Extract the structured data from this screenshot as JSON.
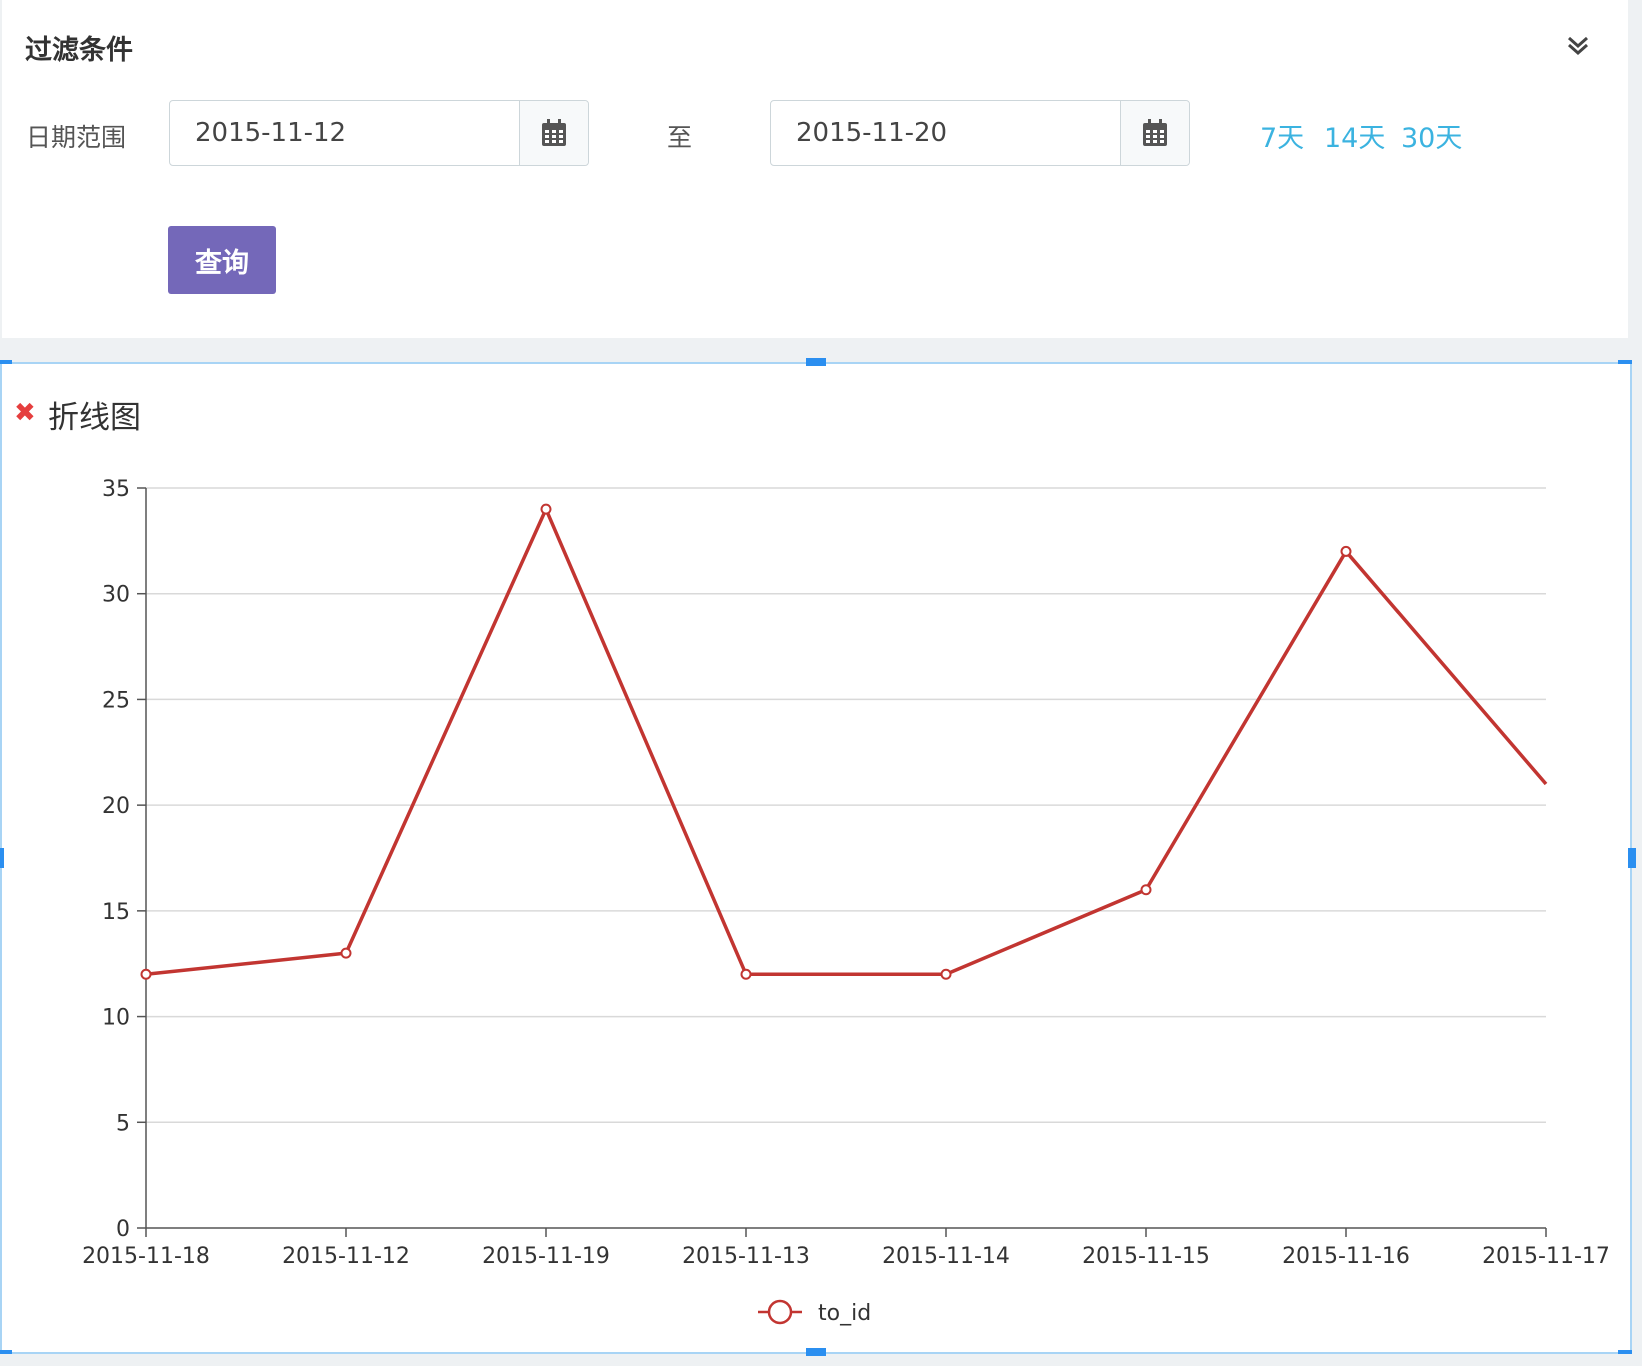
{
  "filter": {
    "title": "过滤条件",
    "date_range_label": "日期范围",
    "start_date": "2015-11-12",
    "end_date": "2015-11-20",
    "to_label": "至",
    "quick_ranges": [
      "7天",
      "14天",
      "30天"
    ],
    "query_button": "查询"
  },
  "icons": {
    "collapse": "double-chevron-down-icon",
    "calendar": "calendar-icon",
    "close": "close-icon"
  },
  "colors": {
    "accent": "#7468b9",
    "link": "#3bb3e0",
    "series": "#c23531",
    "close": "#e53e3e",
    "selection": "#2b8ff0"
  },
  "chart_panel": {
    "title": "折线图"
  },
  "chart_data": {
    "type": "line",
    "categories": [
      "2015-11-18",
      "2015-11-12",
      "2015-11-19",
      "2015-11-13",
      "2015-11-14",
      "2015-11-15",
      "2015-11-16",
      "2015-11-17"
    ],
    "series": [
      {
        "name": "to_id",
        "values": [
          12,
          13,
          34,
          12,
          12,
          16,
          32,
          21
        ]
      }
    ],
    "ylim": [
      0,
      35
    ],
    "yticks": [
      0,
      5,
      10,
      15,
      20,
      25,
      30,
      35
    ],
    "grid": true,
    "legend": "bottom-center",
    "title": "",
    "xlabel": "",
    "ylabel": ""
  }
}
